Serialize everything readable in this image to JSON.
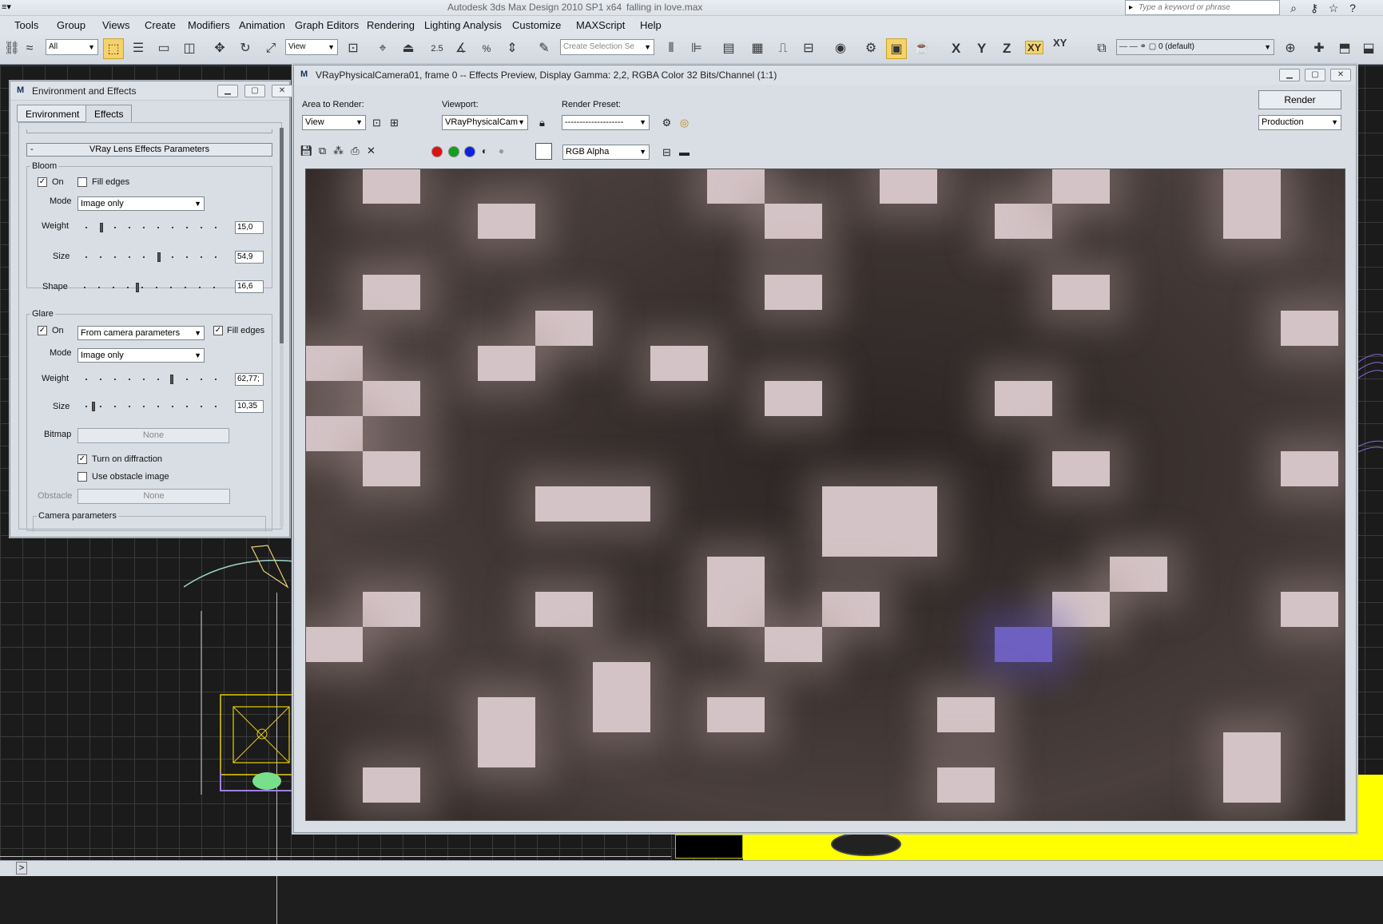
{
  "app": {
    "title": "Autodesk 3ds Max Design 2010 SP1 x64",
    "file": "falling in love.max",
    "search_placeholder": "Type a keyword or phrase"
  },
  "menu": [
    "Tools",
    "Group",
    "Views",
    "Create",
    "Modifiers",
    "Animation",
    "Graph Editors",
    "Rendering",
    "Lighting Analysis",
    "Customize",
    "MAXScript",
    "Help"
  ],
  "toolbar": {
    "selection_filter": "All",
    "reference_coord": "View",
    "snap_label": "2.5",
    "named_selection_placeholder": "Create Selection Se",
    "axes": [
      "X",
      "Y",
      "Z",
      "XY",
      "XY"
    ],
    "layer": "0 (default)"
  },
  "env_dialog": {
    "title": "Environment and Effects",
    "tabs": [
      "Environment",
      "Effects"
    ],
    "rollout_title": "VRay Lens Effects Parameters",
    "bloom": {
      "group": "Bloom",
      "on_label": "On",
      "on_checked": true,
      "fill_edges_label": "Fill edges",
      "fill_edges_checked": false,
      "mode_label": "Mode",
      "mode_value": "Image only",
      "weight_label": "Weight",
      "weight_value": "15,0",
      "size_label": "Size",
      "size_value": "54,9",
      "shape_label": "Shape",
      "shape_value": "16,6"
    },
    "glare": {
      "group": "Glare",
      "on_label": "On",
      "on_checked": true,
      "source_value": "From camera parameters",
      "fill_edges_label": "Fill edges",
      "fill_edges_checked": true,
      "mode_label": "Mode",
      "mode_value": "Image only",
      "weight_label": "Weight",
      "weight_value": "62,77;",
      "size_label": "Size",
      "size_value": "10,35",
      "bitmap_label": "Bitmap",
      "bitmap_value": "None",
      "diffraction_label": "Turn on diffraction",
      "diffraction_checked": true,
      "obstacle_image_label": "Use obstacle image",
      "obstacle_image_checked": false,
      "obstacle_label": "Obstacle",
      "obstacle_value": "None",
      "camera_params_label": "Camera parameters"
    }
  },
  "frame_buffer": {
    "title": "VRayPhysicalCamera01, frame 0 -- Effects Preview, Display Gamma: 2,2, RGBA Color 32 Bits/Channel (1:1)",
    "area_label": "Area to Render:",
    "area_value": "View",
    "viewport_label": "Viewport:",
    "viewport_value": "VRayPhysicalCam",
    "preset_label": "Render Preset:",
    "preset_value": "--------------------",
    "render_button": "Render",
    "production_value": "Production",
    "channel_value": "RGB Alpha",
    "colors": {
      "red": "#e01010",
      "green": "#10a020",
      "blue": "#1020e0"
    }
  }
}
